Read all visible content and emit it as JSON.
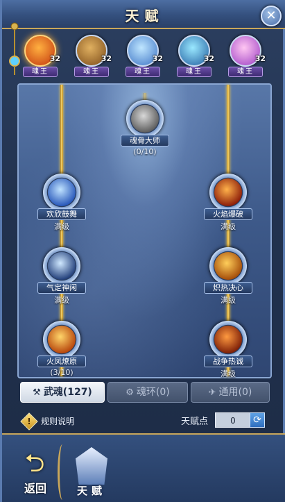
{
  "header": {
    "title": "天赋"
  },
  "souls": [
    {
      "label": "魂王",
      "level": "32",
      "colors": [
        "#ffb040",
        "#c2340c"
      ]
    },
    {
      "label": "魂王",
      "level": "32",
      "colors": [
        "#e0b060",
        "#7a4a18"
      ]
    },
    {
      "label": "魂王",
      "level": "32",
      "colors": [
        "#bfe6ff",
        "#3a72c4"
      ]
    },
    {
      "label": "魂王",
      "level": "32",
      "colors": [
        "#9ae8ff",
        "#1f5c9e"
      ]
    },
    {
      "label": "魂王",
      "level": "32",
      "colors": [
        "#ffc6f2",
        "#9a3ac2"
      ]
    }
  ],
  "talents": {
    "top": {
      "name": "魂骨大师",
      "status": "(0/10)",
      "colors": [
        "#d8d8d8",
        "#5a5a5a"
      ]
    },
    "left": [
      {
        "name": "欢欣鼓舞",
        "status": "满级",
        "colors": [
          "#bfe2ff",
          "#2454b8"
        ]
      },
      {
        "name": "气定神闲",
        "status": "满级",
        "colors": [
          "#cfe8ff",
          "#1f3c78"
        ]
      },
      {
        "name": "火凤燎原",
        "status": "(3/10)",
        "colors": [
          "#ffd56a",
          "#b5420a"
        ]
      }
    ],
    "right": [
      {
        "name": "火焰爆破",
        "status": "满级",
        "colors": [
          "#ffb14a",
          "#8a1a08"
        ]
      },
      {
        "name": "炽热决心",
        "status": "满级",
        "colors": [
          "#ffce5a",
          "#a24a08"
        ]
      },
      {
        "name": "战争热诚",
        "status": "满级",
        "colors": [
          "#ff9a40",
          "#7a1c06"
        ]
      }
    ]
  },
  "tabs": [
    {
      "label": "武魂(127)",
      "icon": "⚒"
    },
    {
      "label": "魂环(0)",
      "icon": "⚙"
    },
    {
      "label": "通用(0)",
      "icon": "✈"
    }
  ],
  "rules": {
    "label": "规则说明"
  },
  "talent_points": {
    "label": "天赋点",
    "value": "0"
  },
  "bottom": {
    "back_label": "返回",
    "talent_label": "天赋"
  }
}
